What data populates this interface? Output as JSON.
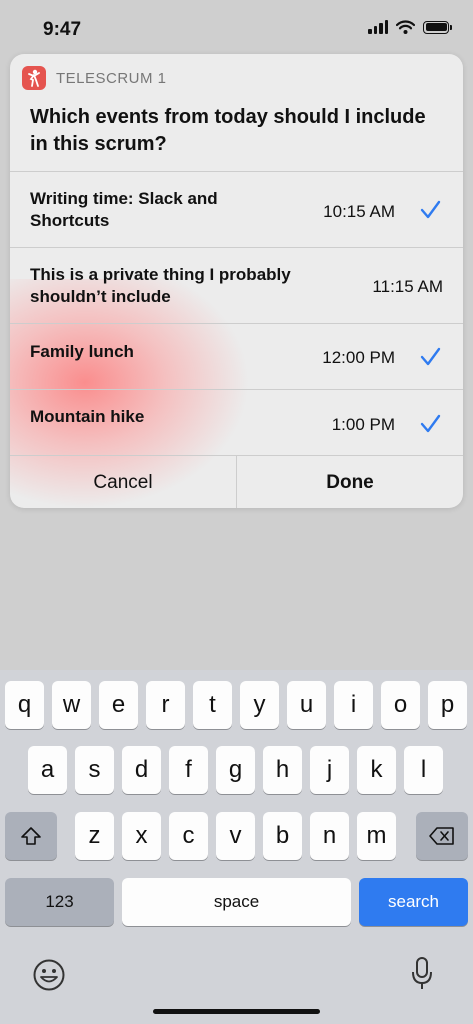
{
  "status_bar": {
    "time": "9:47"
  },
  "app": {
    "name": "TELESCRUM 1",
    "accent_color": "#e5544f",
    "icon": "person-icon"
  },
  "prompt": {
    "question": "Which events from today should I include in this scrum?"
  },
  "events": [
    {
      "title": "Writing time: Slack and Shortcuts",
      "time": "10:15 AM",
      "checked": true
    },
    {
      "title": "This is a private thing I probably shouldn’t include",
      "time": "11:15 AM",
      "checked": false
    },
    {
      "title": "Family lunch",
      "time": "12:00 PM",
      "checked": true
    },
    {
      "title": "Mountain hike",
      "time": "1:00 PM",
      "checked": true
    }
  ],
  "actions": {
    "cancel": "Cancel",
    "done": "Done"
  },
  "check_color": "#2f7bf0",
  "keyboard": {
    "row1": [
      "q",
      "w",
      "e",
      "r",
      "t",
      "y",
      "u",
      "i",
      "o",
      "p"
    ],
    "row2": [
      "a",
      "s",
      "d",
      "f",
      "g",
      "h",
      "j",
      "k",
      "l"
    ],
    "row3": [
      "z",
      "x",
      "c",
      "v",
      "b",
      "n",
      "m"
    ],
    "numbers_key": "123",
    "space_key": "space",
    "return_key": "search",
    "return_color": "#2f7bf0"
  }
}
